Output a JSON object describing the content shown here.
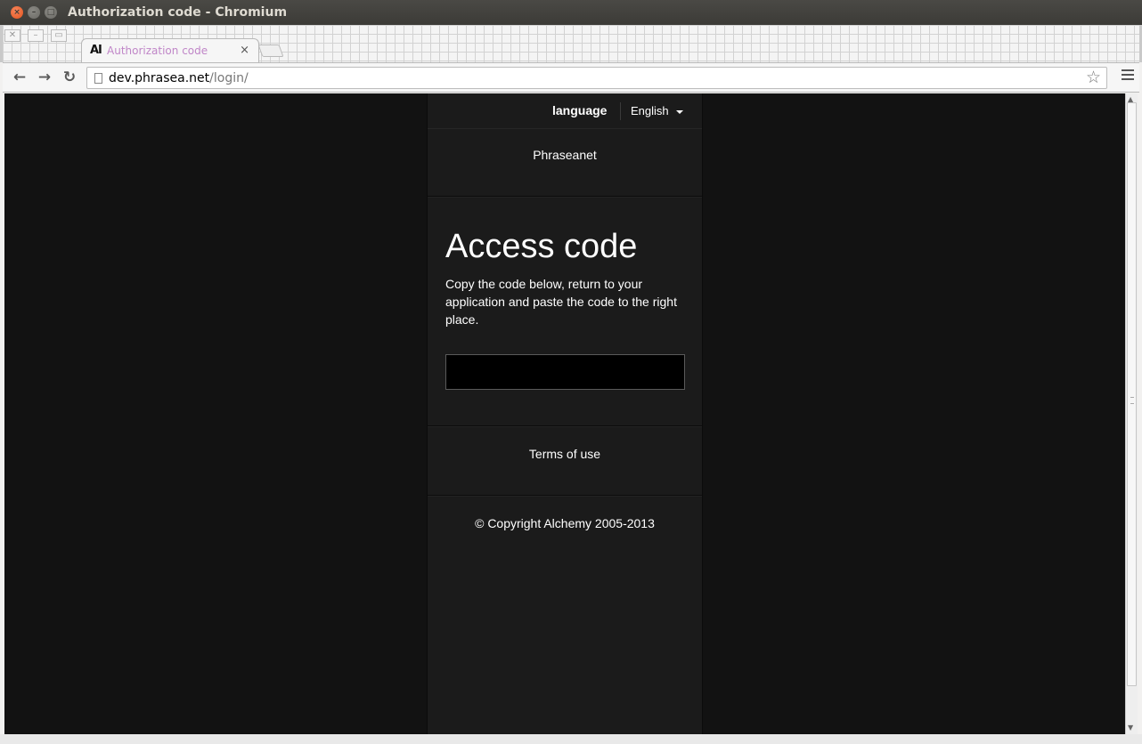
{
  "window": {
    "title": "Authorization code - Chromium",
    "close_glyph": "×",
    "minimize_glyph": "–",
    "maximize_glyph": "□"
  },
  "tabstrip": {
    "tabs": [
      {
        "favicon_text": "AI",
        "title": "Authorization code",
        "close_glyph": "×"
      }
    ]
  },
  "toolbar": {
    "back_glyph": "←",
    "forward_glyph": "→",
    "reload_glyph": "↻",
    "url_host": "dev.phrasea.net",
    "url_path": "/login/",
    "bookmark_glyph": "☆"
  },
  "page": {
    "language_label": "language",
    "language_selected": "English",
    "brand": "Phraseanet",
    "heading": "Access code",
    "description": "Copy the code below, return to your application and paste the code to the right place.",
    "code_value": "",
    "terms_link": "Terms of use",
    "copyright": "© Copyright Alchemy 2005-2013"
  },
  "colors": {
    "page_background": "#121212",
    "panel_background": "#1b1b1b",
    "code_field_background": "#000000",
    "tab_title": "#c086c8"
  },
  "icons": [
    "close-icon",
    "minimize-icon",
    "maximize-icon",
    "back-icon",
    "forward-icon",
    "reload-icon",
    "page-icon",
    "star-icon",
    "menu-icon",
    "caret-down-icon"
  ]
}
